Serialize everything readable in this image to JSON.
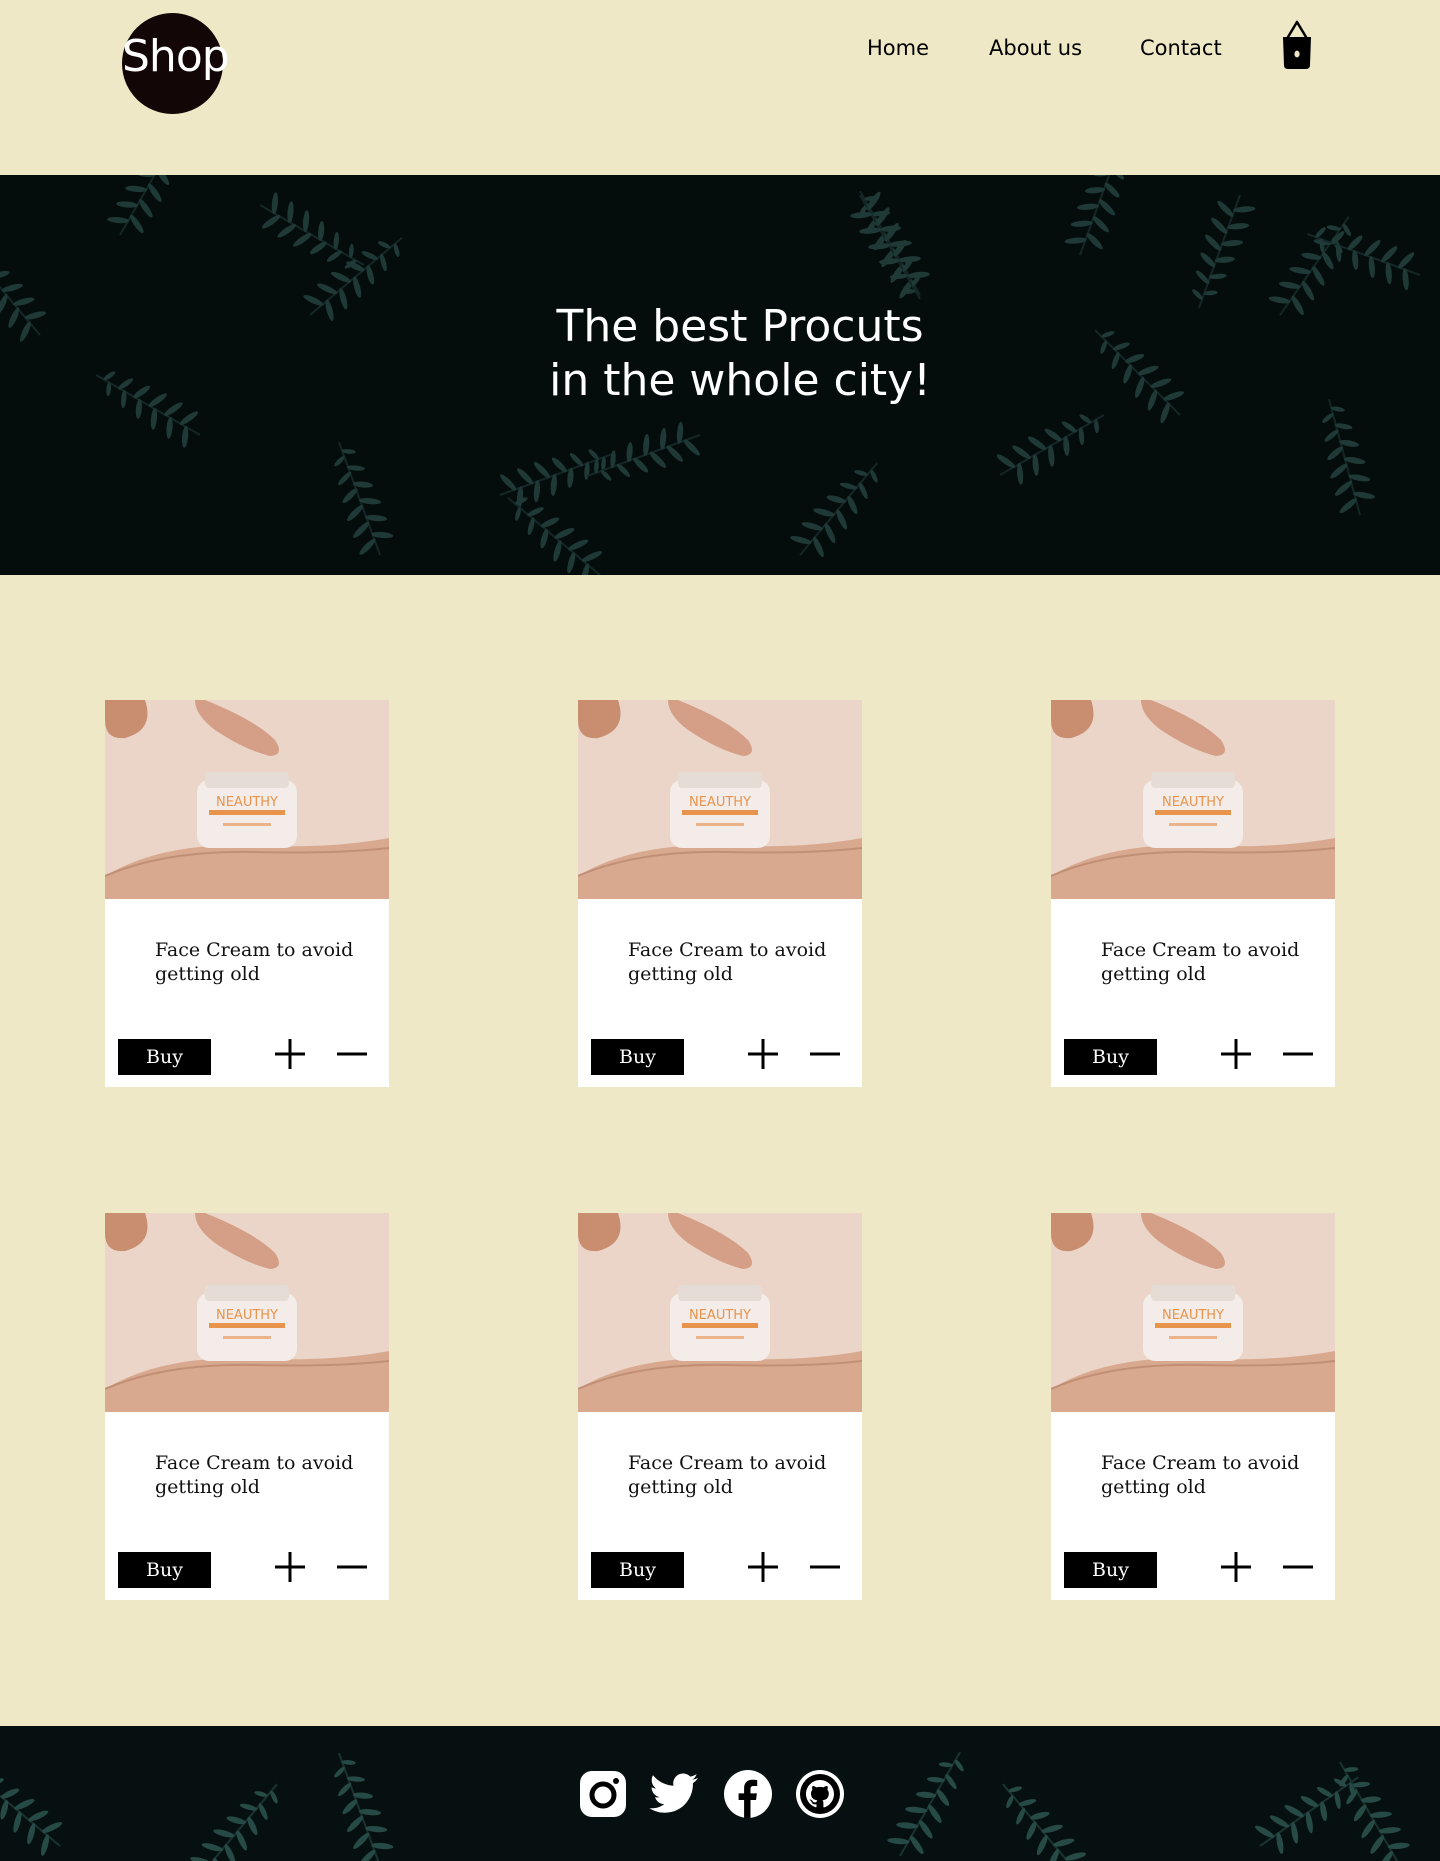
{
  "header": {
    "logo_text": "Shop",
    "nav": [
      {
        "label": "Home"
      },
      {
        "label": "About us"
      },
      {
        "label": "Contact"
      }
    ],
    "cart_icon": "shopping-bag-icon"
  },
  "hero": {
    "title_line1": "The best Procuts",
    "title_line2": "in the whole city!"
  },
  "products": [
    {
      "title": "Face Cream to avoid getting old",
      "buy_label": "Buy",
      "jar_brand": "NEAUTHY"
    },
    {
      "title": "Face Cream to avoid getting old",
      "buy_label": "Buy",
      "jar_brand": "NEAUTHY"
    },
    {
      "title": "Face Cream to avoid getting old",
      "buy_label": "Buy",
      "jar_brand": "NEAUTHY"
    },
    {
      "title": "Face Cream to avoid getting old",
      "buy_label": "Buy",
      "jar_brand": "NEAUTHY"
    },
    {
      "title": "Face Cream to avoid getting old",
      "buy_label": "Buy",
      "jar_brand": "NEAUTHY"
    },
    {
      "title": "Face Cream to avoid getting old",
      "buy_label": "Buy",
      "jar_brand": "NEAUTHY"
    }
  ],
  "footer": {
    "social": [
      "instagram-icon",
      "twitter-icon",
      "facebook-icon",
      "github-icon"
    ]
  },
  "colors": {
    "page_background": "#eee8c6",
    "logo_background": "#130607",
    "button_background": "#000000",
    "card_background": "#ffffff",
    "product_image_background": "#ead5c8",
    "foliage_dark": "#071010",
    "foliage_leaf": "#2e5a55"
  }
}
